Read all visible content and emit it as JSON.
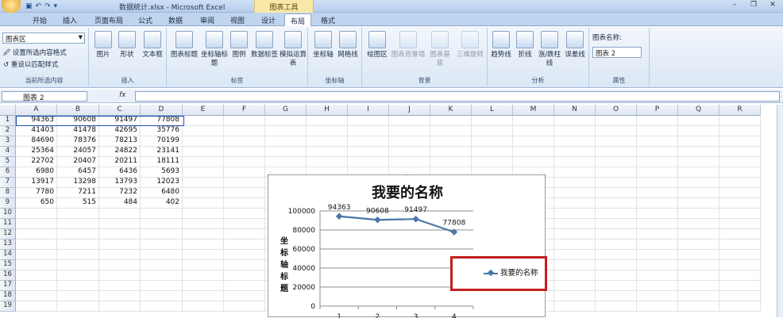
{
  "window": {
    "title": "数据统计.xlsx - Microsoft Excel",
    "context_tab_group": "图表工具"
  },
  "tabs": [
    "开始",
    "插入",
    "页面布局",
    "公式",
    "数据",
    "审阅",
    "视图",
    "设计",
    "布局",
    "格式"
  ],
  "active_tab": "布局",
  "ribbon": {
    "current_selection": {
      "dropdown_value": "图表区",
      "format_selection": "设置所选内容格式",
      "reset_style": "重设以匹配样式",
      "group_label": "当前所选内容"
    },
    "insert": {
      "buttons": [
        "图片",
        "形状",
        "文本框"
      ],
      "group_label": "插入"
    },
    "labels": {
      "buttons": [
        "图表标题",
        "坐标轴标题",
        "图例",
        "数据标签",
        "模拟运算表"
      ],
      "group_label": "标签"
    },
    "axes": {
      "buttons": [
        "坐标轴",
        "网格线"
      ],
      "group_label": "坐标轴"
    },
    "background": {
      "buttons": [
        "绘图区",
        "图表背景墙",
        "图表基底",
        "三维旋转"
      ],
      "group_label": "背景"
    },
    "analysis": {
      "buttons": [
        "趋势线",
        "折线",
        "涨/跌柱线",
        "误差线"
      ],
      "group_label": "分析"
    },
    "properties": {
      "chart_name_label": "图表名称:",
      "chart_name_value": "图表 2",
      "group_label": "属性"
    }
  },
  "formula_bar": {
    "name_box": "图表 2",
    "fx": "fx",
    "formula": ""
  },
  "sheet": {
    "columns": [
      "A",
      "B",
      "C",
      "D",
      "E",
      "F",
      "G",
      "H",
      "I",
      "J",
      "K",
      "L",
      "M",
      "N",
      "O",
      "P",
      "Q",
      "R"
    ],
    "rows": [
      "1",
      "2",
      "3",
      "4",
      "5",
      "6",
      "7",
      "8",
      "9",
      "10",
      "11",
      "12",
      "13",
      "14",
      "15",
      "16",
      "17",
      "18",
      "19"
    ],
    "data": [
      [
        "94363",
        "90608",
        "91497",
        "77808"
      ],
      [
        "41403",
        "41478",
        "42695",
        "35776"
      ],
      [
        "84690",
        "78376",
        "78213",
        "70199"
      ],
      [
        "25364",
        "24057",
        "24822",
        "23141"
      ],
      [
        "22702",
        "20407",
        "20211",
        "18111"
      ],
      [
        "6980",
        "6457",
        "6436",
        "5693"
      ],
      [
        "13917",
        "13298",
        "13793",
        "12023"
      ],
      [
        "7780",
        "7211",
        "7232",
        "6480"
      ],
      [
        "650",
        "515",
        "484",
        "402"
      ]
    ]
  },
  "chart_data": {
    "type": "line",
    "title": "我要的名称",
    "ylabel": "坐标轴标题",
    "xlabel": "",
    "categories": [
      "1",
      "2",
      "3",
      "4"
    ],
    "series": [
      {
        "name": "我要的名称",
        "values": [
          94363,
          90608,
          91497,
          77808
        ],
        "color": "#4a77a8"
      }
    ],
    "data_labels": [
      "94363",
      "90608",
      "91497",
      "77808"
    ],
    "ylim": [
      0,
      100000
    ],
    "yticks": [
      "100000",
      "80000",
      "60000",
      "40000",
      "20000",
      "0"
    ],
    "grid": true,
    "legend": "right"
  },
  "colors": {
    "accent": "#4a77a8",
    "highlight_box": "#c41f1f",
    "context_tab": "#f7e8a8"
  }
}
